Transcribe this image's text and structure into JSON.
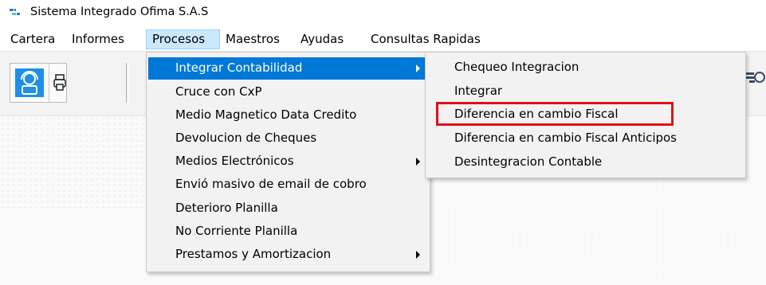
{
  "window": {
    "title": "Sistema Integrado Ofima S.A.S",
    "icon": "app-icon"
  },
  "menubar": {
    "items": [
      {
        "label": "Cartera"
      },
      {
        "label": "Informes"
      },
      {
        "label": "Procesos"
      },
      {
        "label": "Maestros"
      },
      {
        "label": "Ayudas"
      },
      {
        "label": "Consultas Rapidas"
      }
    ]
  },
  "procesos_menu": {
    "items": [
      {
        "label": "Integrar Contabilidad",
        "submenu": true,
        "highlighted": true
      },
      {
        "label": "Cruce con CxP"
      },
      {
        "label": "Medio Magnetico Data Credito"
      },
      {
        "label": "Devolucion de Cheques"
      },
      {
        "label": "Medios Electrónicos",
        "submenu": true
      },
      {
        "label": "Envió masivo de email de cobro"
      },
      {
        "label": "Deterioro Planilla"
      },
      {
        "label": "No Corriente Planilla"
      },
      {
        "label": "Prestamos y Amortizacion",
        "submenu": true
      }
    ]
  },
  "integrar_menu": {
    "items": [
      {
        "label": "Chequeo Integracion"
      },
      {
        "label": "Integrar"
      },
      {
        "label": "Diferencia en cambio Fiscal",
        "annotated": true
      },
      {
        "label": "Diferencia en cambio Fiscal Anticipos"
      },
      {
        "label": "Desintegracion Contable"
      }
    ]
  },
  "colors": {
    "highlight": "#0078d7",
    "annotation": "#e0101a",
    "menu_bg": "#f2f2f2",
    "active_menu": "#cce8ff"
  },
  "icons": [
    "app-icon",
    "customer-support-icon",
    "printer-icon",
    "search-document-icon",
    "submenu-arrow-icon"
  ]
}
